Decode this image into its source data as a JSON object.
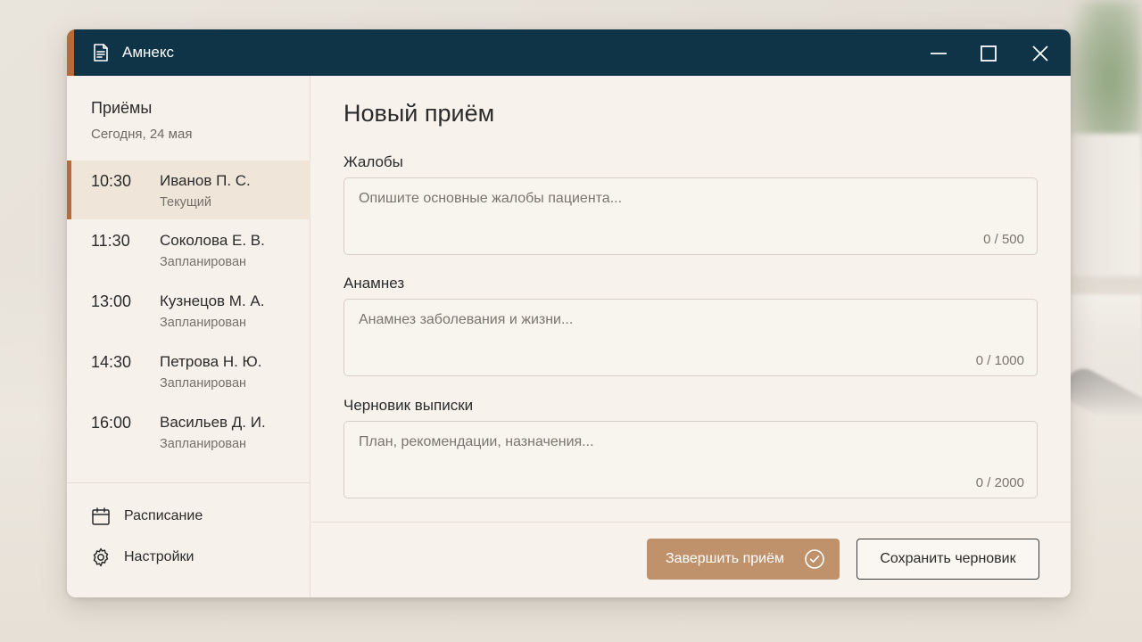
{
  "app": {
    "title": "Амнекс"
  },
  "sidebar": {
    "title": "Приёмы",
    "date": "Сегодня, 24 мая",
    "appointments": [
      {
        "time": "10:30",
        "name": "Иванов П. С.",
        "status": "Текущий",
        "active": true
      },
      {
        "time": "11:30",
        "name": "Соколова Е. В.",
        "status": "Запланирован",
        "active": false
      },
      {
        "time": "13:00",
        "name": "Кузнецов М. А.",
        "status": "Запланирован",
        "active": false
      },
      {
        "time": "14:30",
        "name": "Петрова Н. Ю.",
        "status": "Запланирован",
        "active": false
      },
      {
        "time": "16:00",
        "name": "Васильев Д. И.",
        "status": "Запланирован",
        "active": false
      }
    ],
    "nav": [
      {
        "label": "Расписание",
        "icon": "calendar-icon"
      },
      {
        "label": "Настройки",
        "icon": "gear-icon"
      }
    ]
  },
  "main": {
    "title": "Новый приём",
    "fields": [
      {
        "label": "Жалобы",
        "placeholder": "Опишите основные жалобы пациента...",
        "counter": "0 / 500"
      },
      {
        "label": "Анамнез",
        "placeholder": "Анамнез заболевания и жизни...",
        "counter": "0 / 1000"
      },
      {
        "label": "Черновик выписки",
        "placeholder": "План, рекомендации, назначения...",
        "counter": "0 / 2000"
      }
    ],
    "buttons": {
      "complete": "Завершить приём",
      "save_draft": "Сохранить черновик"
    }
  },
  "colors": {
    "titlebar": "#0f3447",
    "accent": "#b86a3b",
    "primary_button": "#c0926c",
    "active_row": "#efe5d9"
  }
}
